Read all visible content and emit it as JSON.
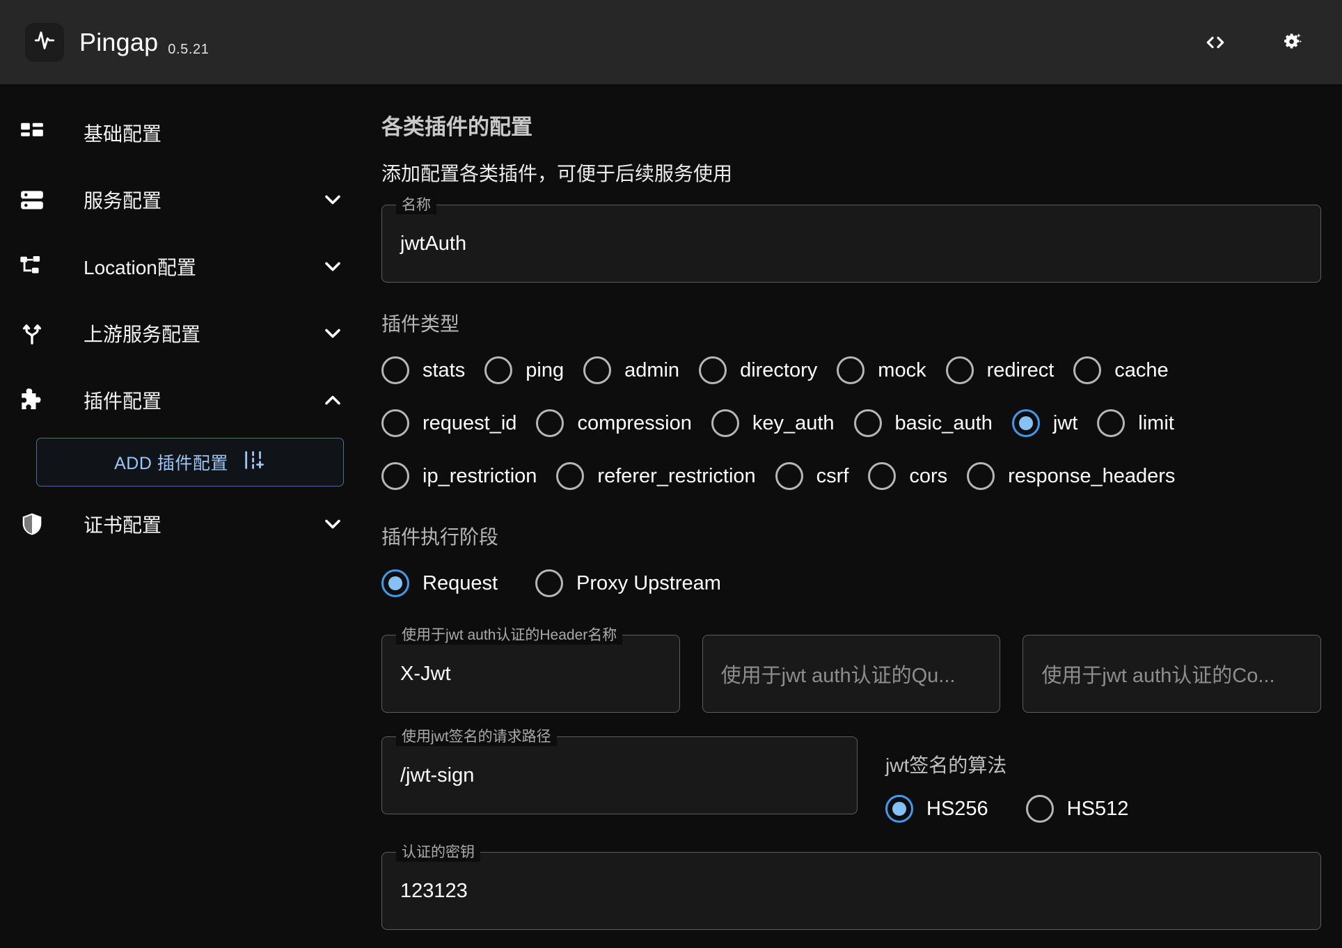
{
  "header": {
    "logo_icon": "activity-pulse-icon",
    "title": "Pingap",
    "version": "0.5.21",
    "code_icon": "code-brackets-icon",
    "settings_icon": "gear-sparkle-icon"
  },
  "sidebar": {
    "items": [
      {
        "label": "基础配置",
        "icon": "dashboard-icon",
        "expandable": false,
        "expanded": false
      },
      {
        "label": "服务配置",
        "icon": "server-icon",
        "expandable": true,
        "expanded": false
      },
      {
        "label": "Location配置",
        "icon": "sitemap-icon",
        "expandable": true,
        "expanded": false
      },
      {
        "label": "上游服务配置",
        "icon": "branch-icon",
        "expandable": true,
        "expanded": false
      },
      {
        "label": "插件配置",
        "icon": "puzzle-icon",
        "expandable": true,
        "expanded": true
      },
      {
        "label": "证书配置",
        "icon": "shield-icon",
        "expandable": true,
        "expanded": false
      }
    ],
    "add_button": {
      "label": "ADD 插件配置",
      "icon": "add-column-icon"
    }
  },
  "main": {
    "title": "各类插件的配置",
    "subtitle": "添加配置各类插件，可便于后续服务使用",
    "name_field": {
      "legend": "名称",
      "value": "jwtAuth"
    },
    "plugin_type": {
      "label": "插件类型",
      "selected": "jwt",
      "rows": [
        [
          "stats",
          "ping",
          "admin",
          "directory",
          "mock",
          "redirect",
          "cache"
        ],
        [
          "request_id",
          "compression",
          "key_auth",
          "basic_auth",
          "jwt",
          "limit"
        ],
        [
          "ip_restriction",
          "referer_restriction",
          "csrf",
          "cors",
          "response_headers"
        ]
      ]
    },
    "plugin_step": {
      "label": "插件执行阶段",
      "selected": "Request",
      "options": [
        "Request",
        "Proxy Upstream"
      ]
    },
    "header_field": {
      "legend": "使用于jwt auth认证的Header名称",
      "value": "X-Jwt"
    },
    "query_field": {
      "placeholder": "使用于jwt auth认证的Qu..."
    },
    "cookie_field": {
      "placeholder": "使用于jwt auth认证的Co..."
    },
    "sign_path_field": {
      "legend": "使用jwt签名的请求路径",
      "value": "/jwt-sign"
    },
    "algorithm": {
      "label": "jwt签名的算法",
      "selected": "HS256",
      "options": [
        "HS256",
        "HS512"
      ]
    },
    "secret_field": {
      "legend": "认证的密钥",
      "value": "123123"
    }
  },
  "colors": {
    "accent": "#3f9bef",
    "accent_soft": "#85c1f5",
    "appbar_bg": "#272727",
    "page_bg": "#0d0d0d",
    "field_bg": "#191919",
    "border": "#5d5d5d",
    "add_border": "#4f6d93",
    "add_text": "#9ac6f5"
  }
}
